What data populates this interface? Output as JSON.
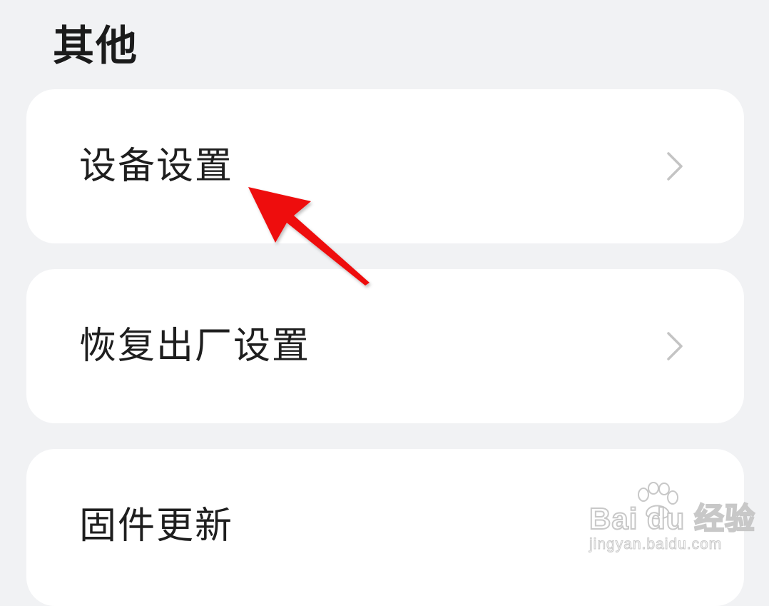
{
  "section": {
    "title": "其他"
  },
  "items": [
    {
      "label": "设备设置",
      "icon": "chevron-right-icon"
    },
    {
      "label": "恢复出厂设置",
      "icon": "chevron-right-icon"
    },
    {
      "label": "固件更新"
    }
  ],
  "watermark": {
    "brand": "Bai du 经验",
    "url": "jingyan.baidu.com"
  },
  "colors": {
    "background": "#f1f2f4",
    "card": "#ffffff",
    "text": "#1e1e1e",
    "chevron": "#c4c4c4",
    "annotation_arrow": "#ee1111"
  }
}
